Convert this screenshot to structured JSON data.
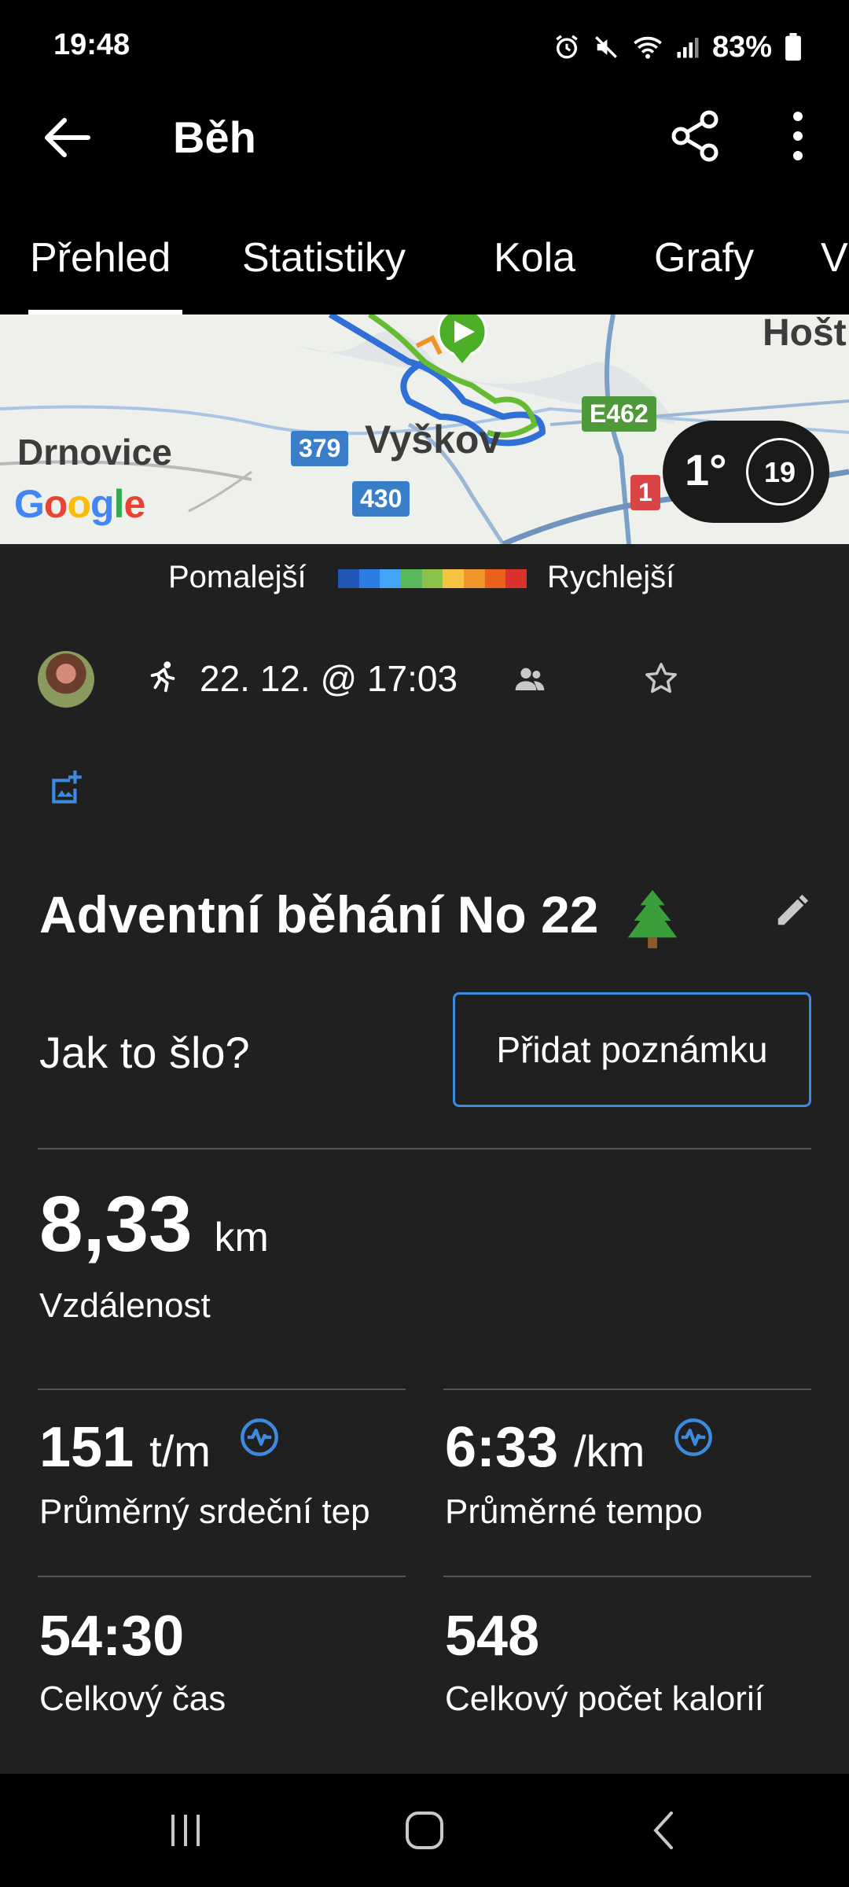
{
  "status": {
    "time": "19:48",
    "battery": "83%"
  },
  "appbar": {
    "title": "Běh"
  },
  "tabs": [
    {
      "label": "Přehled",
      "active": true
    },
    {
      "label": "Statistiky"
    },
    {
      "label": "Kola"
    },
    {
      "label": "Grafy"
    },
    {
      "label": "V"
    }
  ],
  "map": {
    "places": {
      "drnovice": "Drnovice",
      "vyskov": "Vyškov",
      "host": "Hošt"
    },
    "roads": {
      "r379": "379",
      "r430": "430",
      "e462": "E462",
      "r1": "1"
    },
    "google": [
      "G",
      "o",
      "o",
      "g",
      "l",
      "e"
    ],
    "weather": {
      "temp": "1°",
      "wind": "19"
    }
  },
  "legend": {
    "slow": "Pomalejší",
    "fast": "Rychlejší",
    "colors": [
      "#1f56b8",
      "#2c7be0",
      "#42a5f5",
      "#5cb85c",
      "#8bc34a",
      "#f5c242",
      "#f0932b",
      "#e8621e",
      "#d9312b"
    ]
  },
  "activity": {
    "datetime": "22. 12. @ 17:03",
    "title": "Adventní běhání No 22",
    "how_question": "Jak to šlo?",
    "add_note": "Přidat poznámku"
  },
  "stats": {
    "distance": {
      "value": "8,33",
      "unit": "km",
      "label": "Vzdálenost"
    },
    "heart_rate": {
      "value": "151",
      "unit": "t/m",
      "label": "Průměrný srdeční tep"
    },
    "pace": {
      "value": "6:33",
      "unit": "/km",
      "label": "Průměrné tempo"
    },
    "total_time": {
      "value": "54:30",
      "label": "Celkový čas"
    },
    "calories": {
      "value": "548",
      "label": "Celkový počet kalorií"
    }
  }
}
